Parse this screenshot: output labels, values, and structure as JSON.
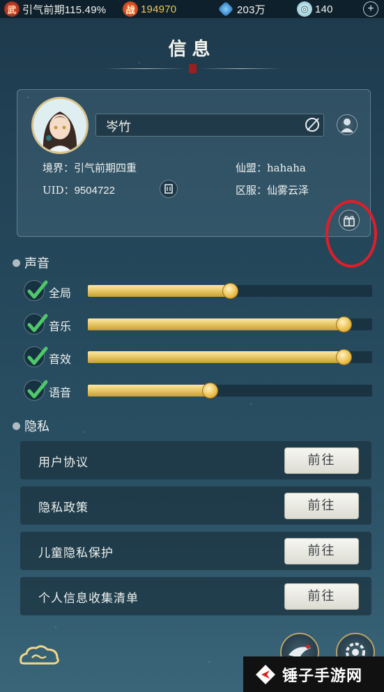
{
  "top_bar": {
    "realm_icon": "wu-badge-icon",
    "realm_progress": "引气前期115.49%",
    "power_icon": "zhan-badge-icon",
    "power_value": "194970",
    "gem_icon": "spirit-gem-icon",
    "gem_value": "203万",
    "jade_icon": "jade-coin-icon",
    "jade_value": "140",
    "plus_label": "+"
  },
  "page": {
    "title": "信息"
  },
  "profile": {
    "name": "岑竹",
    "realm_label": "境界：引气前期四重",
    "uid_label": "UID：",
    "uid_value": "9504722",
    "alliance_label": "仙盟：hahaha",
    "server_label": "区服：仙雾云泽"
  },
  "sound": {
    "heading": "声音",
    "rows": [
      {
        "label": "全局",
        "checked": true,
        "level": 0.5
      },
      {
        "label": "音乐",
        "checked": true,
        "level": 0.9
      },
      {
        "label": "音效",
        "checked": true,
        "level": 0.9
      },
      {
        "label": "语音",
        "checked": true,
        "level": 0.43
      }
    ]
  },
  "privacy": {
    "heading": "隐私",
    "rows": [
      {
        "label": "用户协议",
        "button": "前往"
      },
      {
        "label": "隐私政策",
        "button": "前往"
      },
      {
        "label": "儿童隐私保护",
        "button": "前往"
      },
      {
        "label": "个人信息收集清单",
        "button": "前往"
      }
    ]
  },
  "watermark": {
    "text": "锤子手游网"
  },
  "colors": {
    "accent_gold": "#e4c25f",
    "annotation_red": "#e01e2a"
  }
}
